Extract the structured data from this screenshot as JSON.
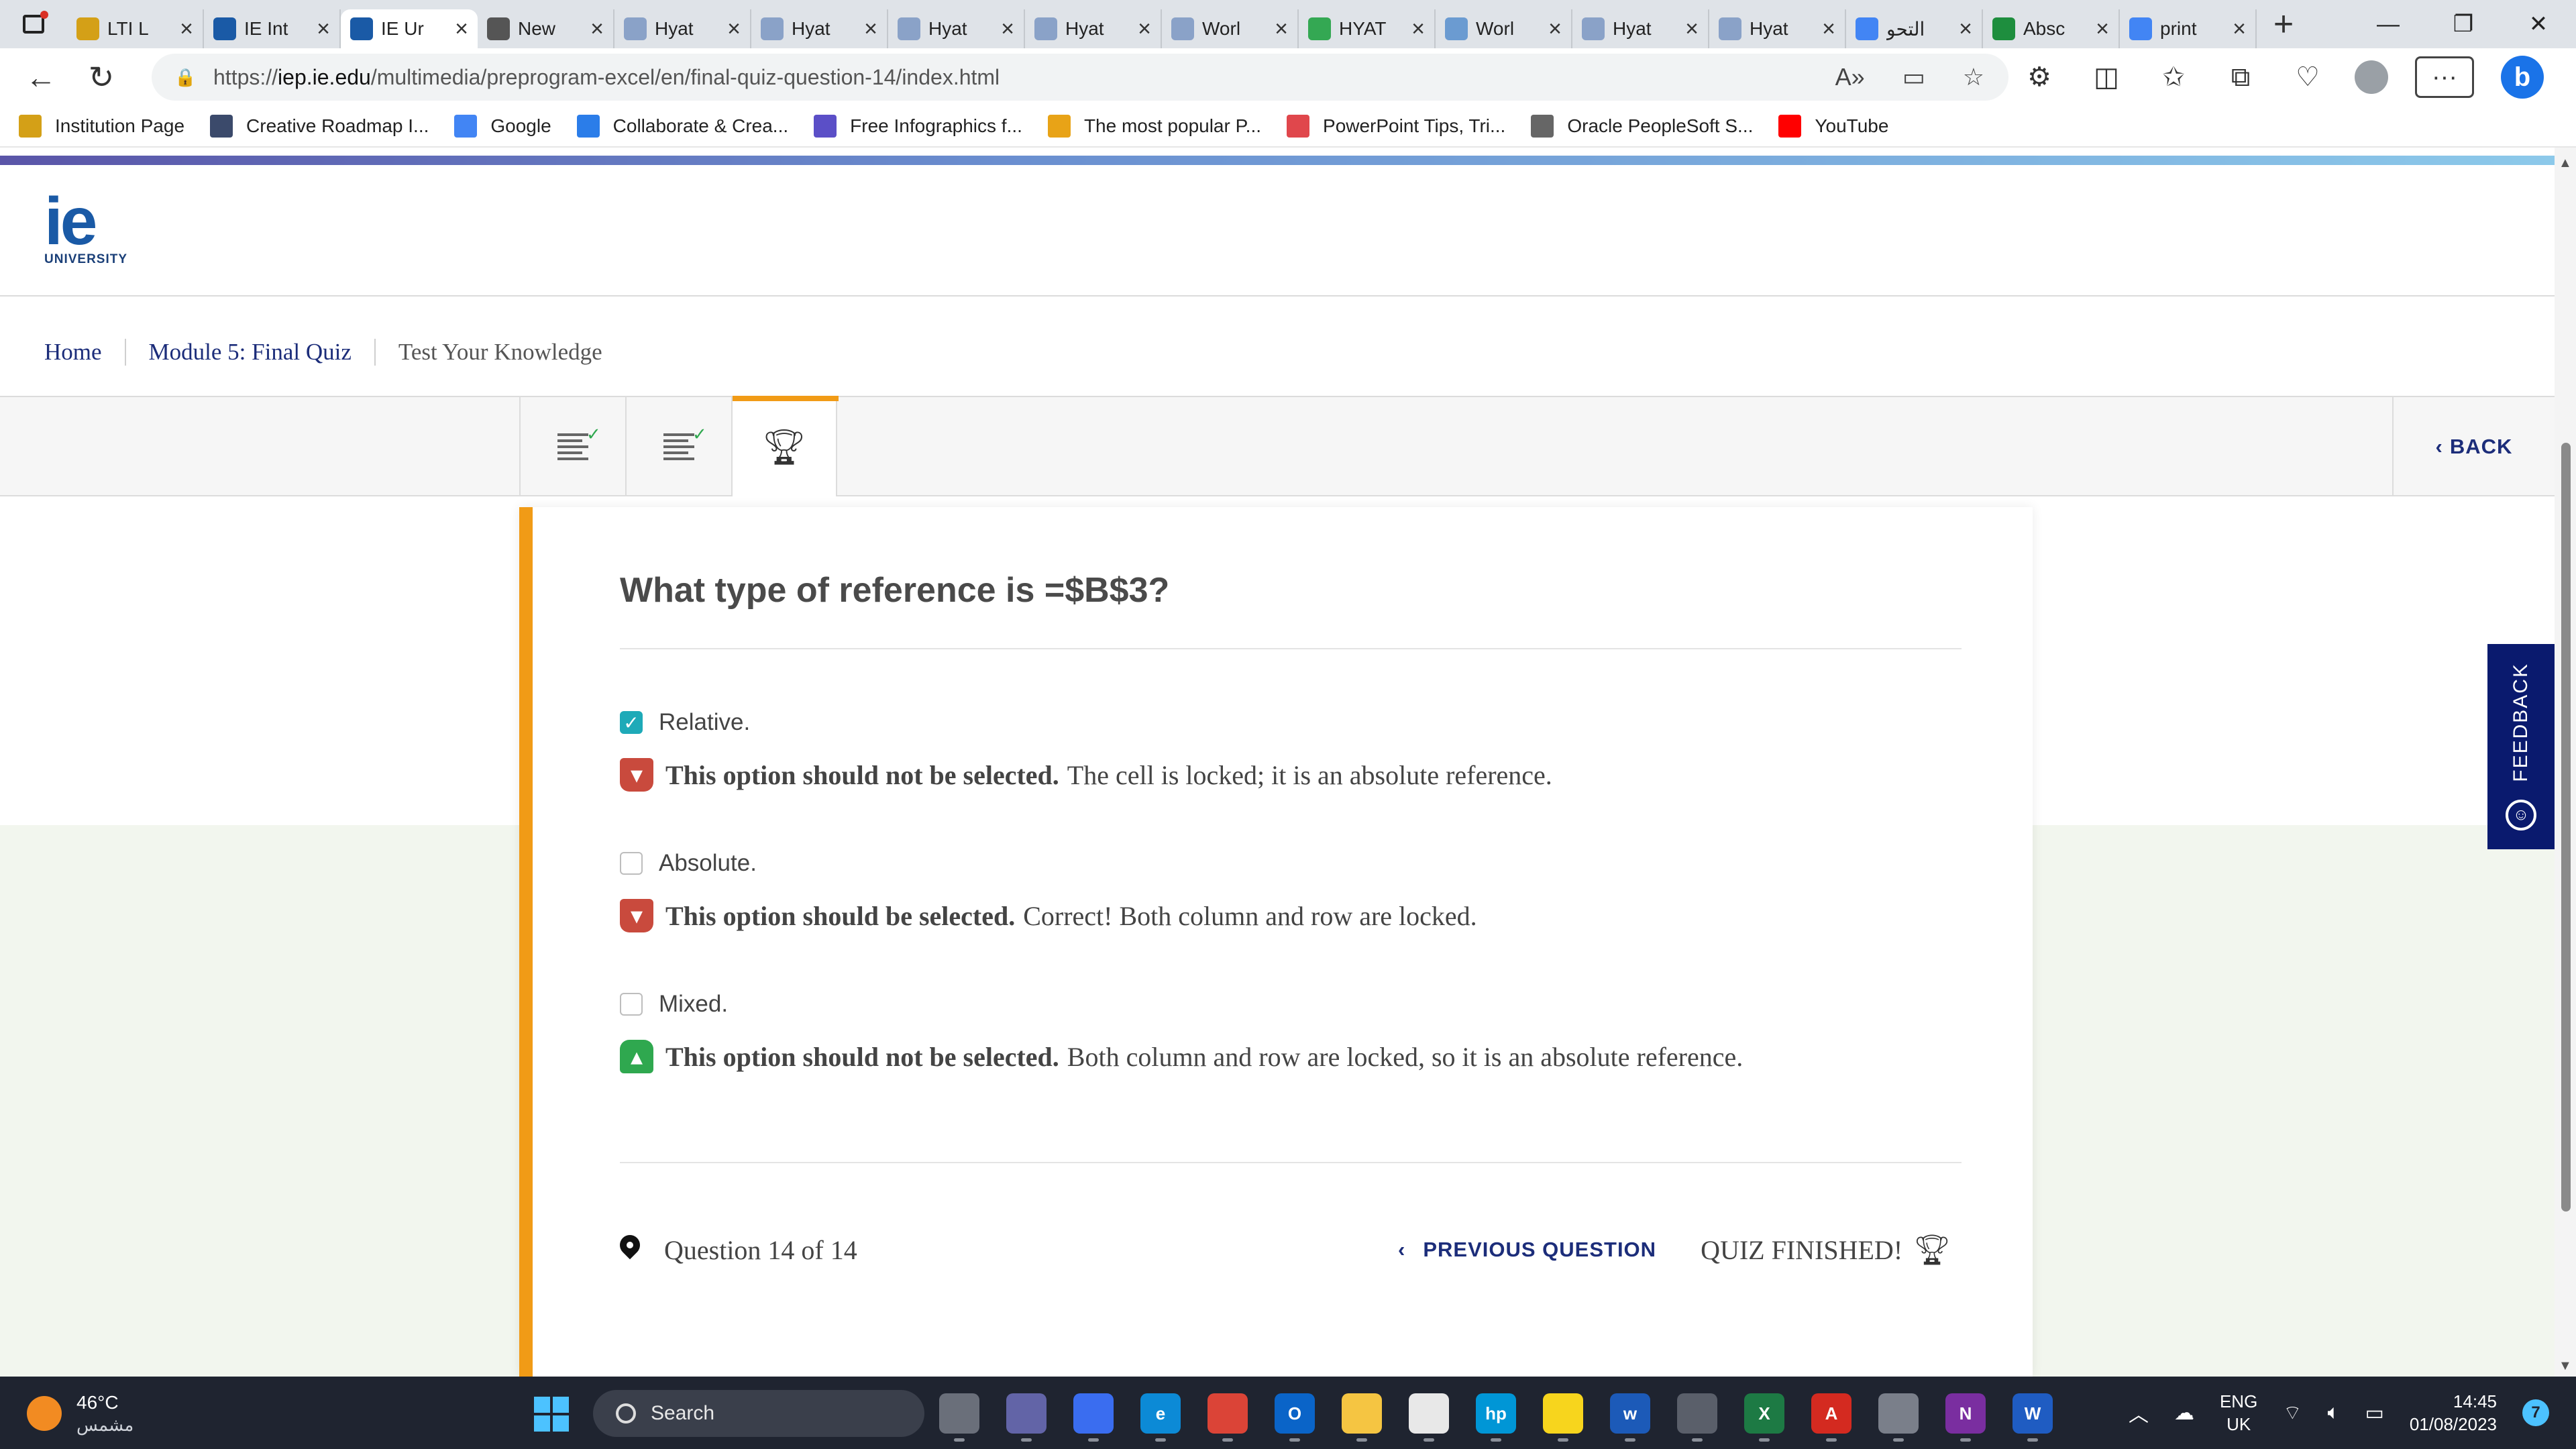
{
  "browser": {
    "tabs": [
      {
        "label": "LTI L",
        "favicon": "bars-chart-favicon",
        "color": "#d4a017",
        "active": false
      },
      {
        "label": "IE Int",
        "favicon": "ie-favicon",
        "color": "#1a5aa6",
        "active": false
      },
      {
        "label": "IE Ur",
        "favicon": "ie-favicon",
        "color": "#1a5aa6",
        "active": true
      },
      {
        "label": "New",
        "favicon": "newtab-favicon",
        "color": "#555555",
        "active": false
      },
      {
        "label": "Hyat",
        "favicon": "h-favicon",
        "color": "#8aa2c8",
        "active": false
      },
      {
        "label": "Hyat",
        "favicon": "h-favicon",
        "color": "#8aa2c8",
        "active": false
      },
      {
        "label": "Hyat",
        "favicon": "h-favicon",
        "color": "#8aa2c8",
        "active": false
      },
      {
        "label": "Hyat",
        "favicon": "h-favicon",
        "color": "#8aa2c8",
        "active": false
      },
      {
        "label": "Worl",
        "favicon": "h-favicon",
        "color": "#8aa2c8",
        "active": false
      },
      {
        "label": "HYAT",
        "favicon": "owl-favicon",
        "color": "#34a853",
        "active": false
      },
      {
        "label": "Worl",
        "favicon": "mountain-favicon",
        "color": "#6b9bd1",
        "active": false
      },
      {
        "label": "Hyat",
        "favicon": "h-favicon",
        "color": "#8aa2c8",
        "active": false
      },
      {
        "label": "Hyat",
        "favicon": "h-favicon",
        "color": "#8aa2c8",
        "active": false
      },
      {
        "label": "التحو",
        "favicon": "google-favicon",
        "color": "#4285f4",
        "active": false
      },
      {
        "label": "Absc",
        "favicon": "sheet-favicon",
        "color": "#1e8e3e",
        "active": false
      },
      {
        "label": "print",
        "favicon": "google-favicon",
        "color": "#4285f4",
        "active": false
      }
    ],
    "url_scheme": "https://",
    "url_host": "iep.ie.edu",
    "url_path": "/multimedia/preprogram-excel/en/final-quiz-question-14/index.html",
    "bookmarks": [
      {
        "label": "Institution Page",
        "icon": "bars-chart-icon",
        "color": "#d4a017"
      },
      {
        "label": "Creative Roadmap I...",
        "icon": "roadmap-icon",
        "color": "#3b4a6b"
      },
      {
        "label": "Google",
        "icon": "google-icon",
        "color": "#4285f4"
      },
      {
        "label": "Collaborate & Crea...",
        "icon": "canva-icon",
        "color": "#2b7de9"
      },
      {
        "label": "Free Infographics f...",
        "icon": "infographic-icon",
        "color": "#5b4fc7"
      },
      {
        "label": "The most popular P...",
        "icon": "presentation-icon",
        "color": "#e8a317"
      },
      {
        "label": "PowerPoint Tips, Tri...",
        "icon": "spark-icon",
        "color": "#e0474c"
      },
      {
        "label": "Oracle PeopleSoft S...",
        "icon": "document-icon",
        "color": "#666666"
      },
      {
        "label": "YouTube",
        "icon": "youtube-icon",
        "color": "#ff0000"
      }
    ]
  },
  "site": {
    "logo_text": "ie",
    "logo_subtitle": "UNIVERSITY",
    "breadcrumb": [
      "Home",
      "Module 5: Final Quiz",
      "Test Your Knowledge"
    ],
    "back_label": "BACK",
    "feedback_label": "FEEDBACK"
  },
  "quiz": {
    "question": "What type of reference is =$B$3?",
    "options": [
      {
        "label": "Relative.",
        "checked": true,
        "feedback_verdict": "This option should not be selected.",
        "feedback_text": "The cell is locked; it is an absolute reference.",
        "thumb": "thumbs-down"
      },
      {
        "label": "Absolute.",
        "checked": false,
        "feedback_verdict": "This option should be selected.",
        "feedback_text": "Correct! Both column and row are locked.",
        "thumb": "thumbs-down"
      },
      {
        "label": "Mixed.",
        "checked": false,
        "feedback_verdict": "This option should not be selected.",
        "feedback_text": "Both column and row are locked, so it is an absolute reference.",
        "thumb": "thumbs-up"
      }
    ],
    "progress_label": "Question 14 of 14",
    "previous_label": "PREVIOUS QUESTION",
    "finished_label": "QUIZ FINISHED!"
  },
  "taskbar": {
    "weather_temp": "46°C",
    "weather_desc": "مشمس",
    "search_label": "Search",
    "lang_top": "ENG",
    "lang_bottom": "UK",
    "time": "14:45",
    "date": "01/08/2023",
    "notifications": "7",
    "apps": [
      {
        "name": "file-explorer-app-icon",
        "color": "#6a6f7a",
        "label": ""
      },
      {
        "name": "teams-app-icon",
        "color": "#6264a7",
        "label": ""
      },
      {
        "name": "copilot-app-icon",
        "color": "#3a6df0",
        "label": ""
      },
      {
        "name": "edge-app-icon",
        "color": "#0c8ad6",
        "label": "e"
      },
      {
        "name": "chrome-app-icon",
        "color": "#db4437",
        "label": ""
      },
      {
        "name": "outlook-app-icon",
        "color": "#0a64c8",
        "label": "O"
      },
      {
        "name": "folder-app-icon",
        "color": "#f5c542",
        "label": ""
      },
      {
        "name": "store-app-icon",
        "color": "#e8e8e8",
        "label": ""
      },
      {
        "name": "myhp-app-icon",
        "color": "#0096d6",
        "label": "hp"
      },
      {
        "name": "sticky-notes-app-icon",
        "color": "#f7d51d",
        "label": ""
      },
      {
        "name": "webex-app-icon",
        "color": "#1c5ab8",
        "label": "w"
      },
      {
        "name": "calculator-app-icon",
        "color": "#5a5f6a",
        "label": ""
      },
      {
        "name": "excel-app-icon",
        "color": "#1d7a44",
        "label": "X"
      },
      {
        "name": "acrobat-app-icon",
        "color": "#d42a20",
        "label": "A"
      },
      {
        "name": "snipping-app-icon",
        "color": "#7a7f8a",
        "label": ""
      },
      {
        "name": "onenote-app-icon",
        "color": "#7a2ea0",
        "label": "N"
      },
      {
        "name": "word-app-icon",
        "color": "#1f5cc2",
        "label": "W"
      }
    ]
  }
}
